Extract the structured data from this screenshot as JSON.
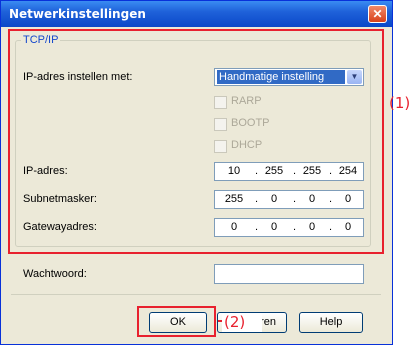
{
  "window": {
    "title": "Netwerkinstellingen",
    "close_glyph": "✕"
  },
  "tcpip": {
    "group_title": "TCP/IP",
    "ip_mode_label": "IP-adres instellen met:",
    "ip_mode_value": "Handmatige instelling",
    "options": [
      {
        "label": "RARP",
        "checked": false,
        "enabled": false
      },
      {
        "label": "BOOTP",
        "checked": false,
        "enabled": false
      },
      {
        "label": "DHCP",
        "checked": false,
        "enabled": false
      }
    ],
    "ip_label": "IP-adres:",
    "ip": [
      "10",
      "255",
      "255",
      "254"
    ],
    "subnet_label": "Subnetmasker:",
    "subnet": [
      "255",
      "0",
      "0",
      "0"
    ],
    "gateway_label": "Gatewayadres:",
    "gateway": [
      "0",
      "0",
      "0",
      "0"
    ]
  },
  "password": {
    "label": "Wachtwoord:",
    "value": ""
  },
  "buttons": {
    "ok": "OK",
    "cancel_partial": "eren",
    "help": "Help"
  },
  "callouts": {
    "one": "(1)",
    "two": "(2)"
  },
  "colors": {
    "titlebar": "#0a47c8",
    "dialog_bg": "#ece9d8",
    "callout": "#e8212e",
    "selection": "#316ac5"
  }
}
